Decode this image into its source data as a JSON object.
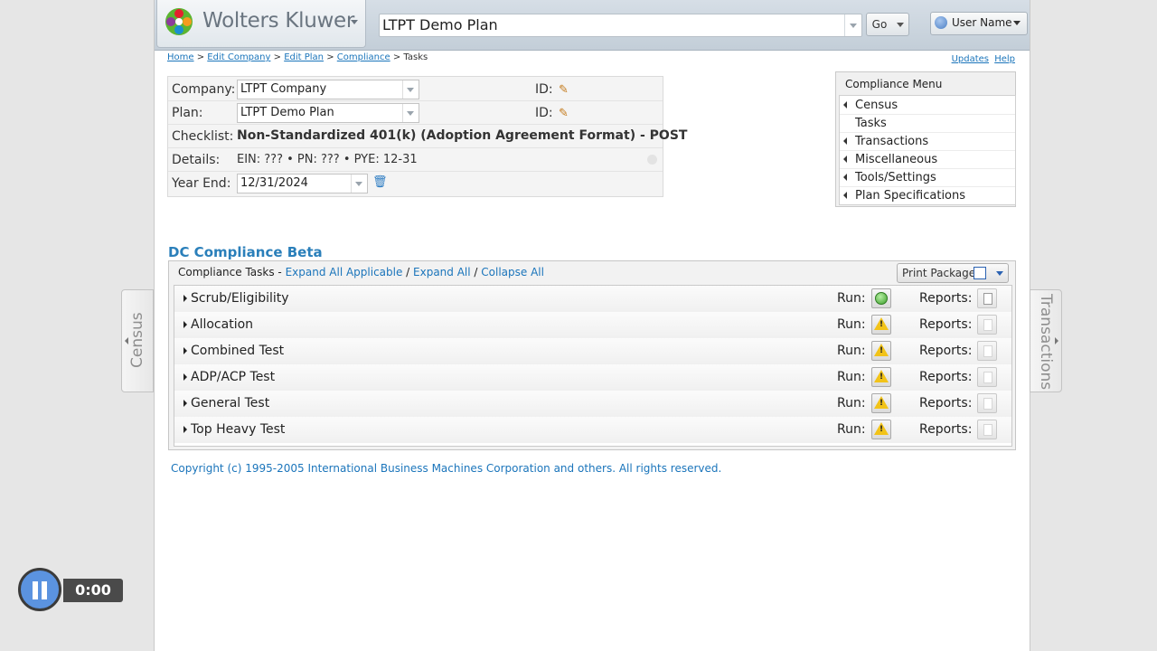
{
  "header": {
    "logo_text": "Wolters Kluwer",
    "plan_selector_value": "LTPT Demo Plan",
    "go_label": "Go",
    "user_label": "User Name"
  },
  "breadcrumb": {
    "items": [
      "Home",
      "Edit Company",
      "Edit Plan",
      "Compliance"
    ],
    "current": "Tasks",
    "separator": ">"
  },
  "help_links": {
    "updates": "Updates",
    "help": "Help"
  },
  "info": {
    "company_label": "Company:",
    "company_value": "LTPT Company",
    "plan_label": "Plan:",
    "plan_value": "LTPT Demo Plan",
    "id_label": "ID:",
    "checklist_label": "Checklist:",
    "checklist_value": "Non-Standardized 401(k) (Adoption Agreement Format) - POST",
    "details_label": "Details:",
    "details_value": "EIN: ??? • PN: ??? • PYE: 12-31",
    "year_end_label": "Year End:",
    "year_end_value": "12/31/2024"
  },
  "compliance_menu": {
    "title": "Compliance Menu",
    "items": [
      {
        "label": "Census",
        "has_arrow": true
      },
      {
        "label": "Tasks",
        "has_arrow": false
      },
      {
        "label": "Transactions",
        "has_arrow": true
      },
      {
        "label": "Miscellaneous",
        "has_arrow": true
      },
      {
        "label": "Tools/Settings",
        "has_arrow": true
      },
      {
        "label": "Plan Specifications",
        "has_arrow": true
      }
    ]
  },
  "dc": {
    "title": "DC Compliance Beta",
    "tasks_label": "Compliance Tasks",
    "expand_all_applicable": "Expand All Applicable",
    "expand_all": "Expand All",
    "collapse_all": "Collapse All",
    "print_package": "Print Package",
    "run_label": "Run:",
    "reports_label": "Reports:",
    "tasks": [
      {
        "name": "Scrub/Eligibility",
        "run_status": "ok",
        "report_available": true
      },
      {
        "name": "Allocation",
        "run_status": "warning",
        "report_available": false
      },
      {
        "name": "Combined Test",
        "run_status": "warning",
        "report_available": false
      },
      {
        "name": "ADP/ACP Test",
        "run_status": "warning",
        "report_available": false
      },
      {
        "name": "General Test",
        "run_status": "warning",
        "report_available": false
      },
      {
        "name": "Top Heavy Test",
        "run_status": "warning",
        "report_available": false
      }
    ]
  },
  "copyright": "Copyright (c) 1995-2005 International Business Machines Corporation and others. All rights reserved.",
  "side_tabs": {
    "left": "Census",
    "right": "Transactions"
  },
  "player": {
    "time": "0:00"
  },
  "colors": {
    "link": "#1b75bb",
    "title_blue": "#2a7fba",
    "ok_green": "#3b9e2a",
    "warning_yellow": "#f2c318"
  }
}
